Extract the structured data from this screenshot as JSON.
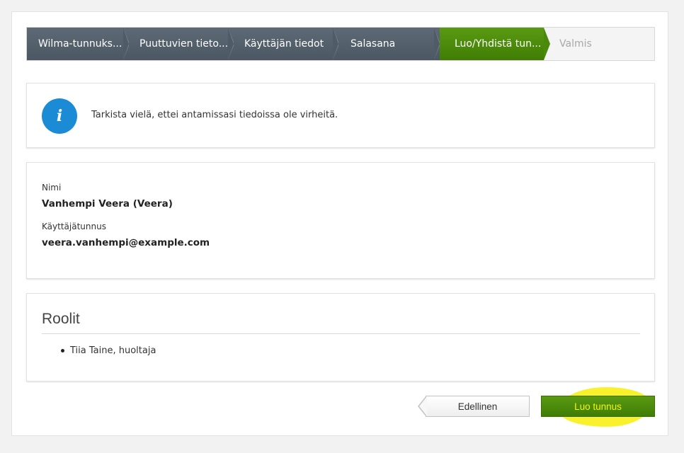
{
  "wizard": {
    "steps": [
      {
        "label": "Wilma-tunnuks...",
        "state": "done"
      },
      {
        "label": "Puuttuvien tieto...",
        "state": "done"
      },
      {
        "label": "Käyttäjän tiedot",
        "state": "done"
      },
      {
        "label": "Salasana",
        "state": "done"
      },
      {
        "label": "Luo/Yhdistä tun...",
        "state": "active"
      },
      {
        "label": "Valmis",
        "state": "pending"
      }
    ]
  },
  "info": {
    "icon": "info-icon",
    "glyph": "i",
    "message": "Tarkista vielä, ettei antamissasi tiedoissa ole virheitä."
  },
  "user": {
    "name_label": "Nimi",
    "name_value": "Vanhempi Veera (Veera)",
    "username_label": "Käyttäjätunnus",
    "username_value": "veera.vanhempi@example.com"
  },
  "roles": {
    "title": "Roolit",
    "items": [
      "Tiia Taine, huoltaja"
    ]
  },
  "actions": {
    "previous_label": "Edellinen",
    "create_label": "Luo tunnus"
  },
  "colors": {
    "active_step": "#4a8a0a",
    "done_step": "#56636f",
    "info_icon": "#1b8bd6",
    "create_button_text": "#f6f600",
    "annotation_highlight": "#f8f014"
  }
}
